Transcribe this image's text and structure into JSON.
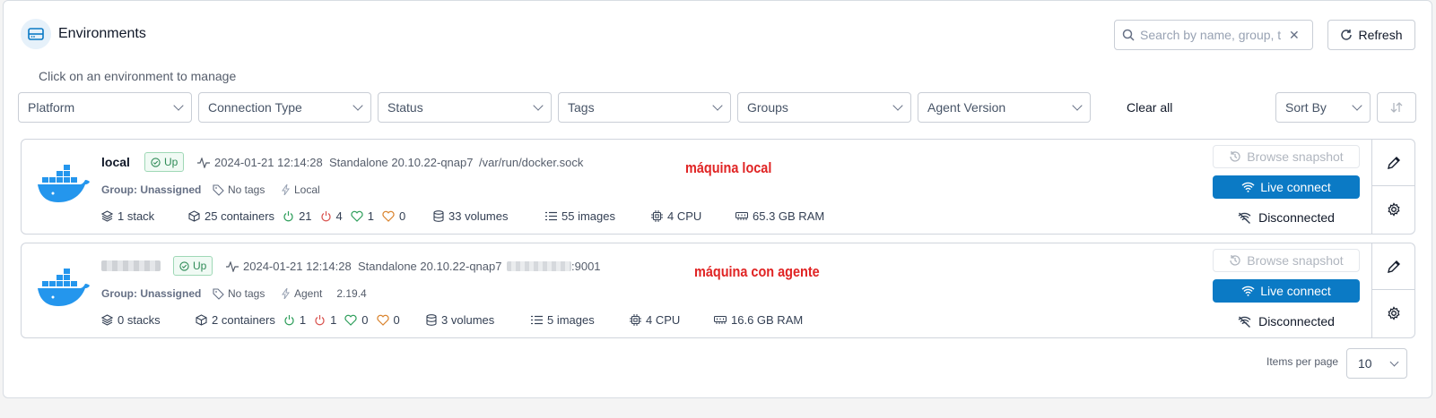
{
  "header": {
    "title": "Environments",
    "search_placeholder": "Search by name, group, t",
    "refresh_label": "Refresh"
  },
  "subtitle": "Click on an environment to manage",
  "filters": {
    "platform": "Platform",
    "connection_type": "Connection Type",
    "status": "Status",
    "tags": "Tags",
    "groups": "Groups",
    "agent_version": "Agent Version",
    "clear_all": "Clear all",
    "sort_by": "Sort By"
  },
  "environments": [
    {
      "name": "local",
      "status": "Up",
      "timestamp": "2024-01-21 12:14:28",
      "engine": "Standalone 20.10.22-qnap7",
      "url": "/var/run/docker.sock",
      "group": "Group: Unassigned",
      "tags": "No tags",
      "type": "Local",
      "agent_version": "",
      "stacks": "1 stack",
      "containers": "25 containers",
      "running": "21",
      "stopped": "4",
      "healthy": "1",
      "unhealthy": "0",
      "volumes": "33 volumes",
      "images": "55 images",
      "cpu": "4 CPU",
      "ram": "65.3 GB RAM",
      "annotation": "máquina local"
    },
    {
      "name": "",
      "status": "Up",
      "timestamp": "2024-01-21 12:14:28",
      "engine": "Standalone 20.10.22-qnap7",
      "url": ":9001",
      "group": "Group: Unassigned",
      "tags": "No tags",
      "type": "Agent",
      "agent_version": "2.19.4",
      "stacks": "0 stacks",
      "containers": "2 containers",
      "running": "1",
      "stopped": "1",
      "healthy": "0",
      "unhealthy": "0",
      "volumes": "3 volumes",
      "images": "5 images",
      "cpu": "4 CPU",
      "ram": "16.6 GB RAM",
      "annotation": "máquina con agente"
    }
  ],
  "actions": {
    "browse_snapshot": "Browse snapshot",
    "live_connect": "Live connect",
    "disconnected": "Disconnected"
  },
  "pagination": {
    "items_per_page_label": "Items per page",
    "items_per_page_value": "10"
  },
  "colors": {
    "accent": "#0b7ac5",
    "up_green": "#2e8b57",
    "annotation_red": "#e02424",
    "docker_blue": "#2496ed"
  }
}
